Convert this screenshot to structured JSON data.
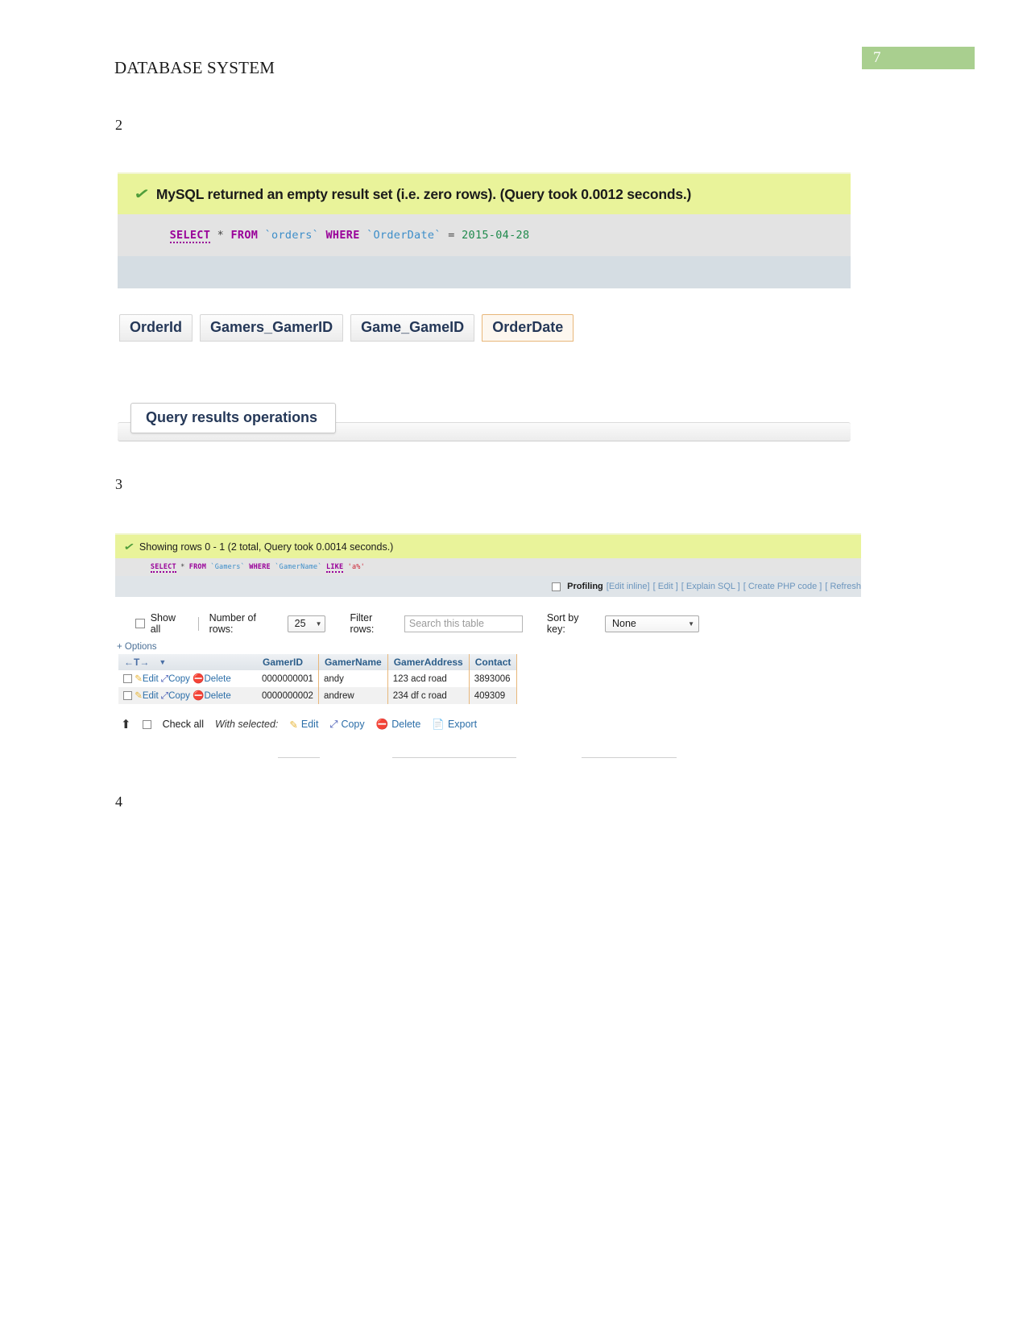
{
  "document": {
    "title": "DATABASE SYSTEM",
    "page_number": "7",
    "accent_green": "#a9cf8f",
    "sections": {
      "two": "2",
      "three": "3",
      "four": "4"
    }
  },
  "block1": {
    "status_icon": "check-icon",
    "status_message": "MySQL returned an empty result set (i.e. zero rows). (Query took 0.0012 seconds.)",
    "sql": {
      "select": "SELECT",
      "star": "*",
      "from": "FROM",
      "table": "`orders`",
      "where": "WHERE",
      "column": "`OrderDate`",
      "equals": "=",
      "value": "2015-04-28",
      "full": "SELECT * FROM `orders` WHERE `OrderDate` = 2015-04-28"
    },
    "columns": [
      {
        "label": "OrderId",
        "active": false
      },
      {
        "label": "Gamers_GamerID",
        "active": false
      },
      {
        "label": "Game_GameID",
        "active": false
      },
      {
        "label": "OrderDate",
        "active": true
      }
    ],
    "query_results_operations": "Query results operations"
  },
  "block2": {
    "status_icon": "check-icon",
    "status_message": "Showing rows 0 - 1 (2 total, Query took 0.0014 seconds.)",
    "sql": {
      "select": "SELECT",
      "star": "*",
      "from": "FROM",
      "table": "`Gamers`",
      "where": "WHERE",
      "column": "`GamerName`",
      "like": "LIKE",
      "value": "'a%'",
      "full": "SELECT * FROM `Gamers` WHERE `GamerName` LIKE 'a%'"
    },
    "links_row": {
      "profiling_label": "Profiling",
      "items": [
        "[Edit inline]",
        "[ Edit ]",
        "[ Explain SQL ]",
        "[ Create PHP code ]",
        "[ Refresh"
      ]
    },
    "options_bar": {
      "show_all_label": "Show all",
      "number_of_rows_label": "Number of rows:",
      "number_of_rows_value": "25",
      "filter_rows_label": "Filter rows:",
      "filter_rows_placeholder": "Search this table",
      "sort_by_key_label": "Sort by key:",
      "sort_by_key_value": "None"
    },
    "options_link": "+ Options",
    "table": {
      "nav_header": "←T→",
      "headers": [
        "GamerID",
        "GamerName",
        "GamerAddress",
        "Contact"
      ],
      "rows": [
        {
          "edit": "Edit",
          "copy": "Copy",
          "delete": "Delete",
          "GamerID": "0000000001",
          "GamerName": "andy",
          "GamerAddress": "123 acd road",
          "Contact": "3893006"
        },
        {
          "edit": "Edit",
          "copy": "Copy",
          "delete": "Delete",
          "GamerID": "0000000002",
          "GamerName": "andrew",
          "GamerAddress": "234 df c  road",
          "Contact": "409309"
        }
      ]
    },
    "bottom_bar": {
      "check_all": "Check all",
      "with_selected": "With selected:",
      "edit": "Edit",
      "copy": "Copy",
      "delete": "Delete",
      "export": "Export"
    }
  }
}
